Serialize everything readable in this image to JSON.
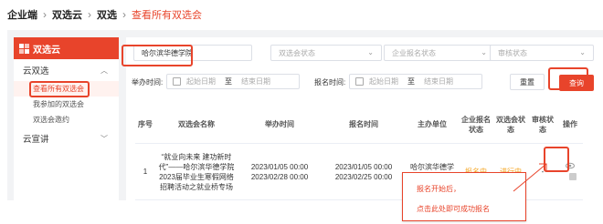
{
  "breadcrumb": {
    "root": "企业端",
    "level1": "双选云",
    "level2": "双选",
    "current": "查看所有双选会"
  },
  "sidebar": {
    "brand": "双选云",
    "groups": [
      {
        "label": "云双选",
        "expanded": true,
        "items": [
          "查看所有双选会",
          "我参加的双选会",
          "双选会邀约"
        ]
      },
      {
        "label": "云宣讲",
        "expanded": false,
        "items": []
      }
    ]
  },
  "filters": {
    "school": "哈尔滨华德学院",
    "status_placeholder": "双选会状态",
    "enroll_placeholder": "企业报名状态",
    "audit_placeholder": "审核状态"
  },
  "dates": {
    "hold_label": "举办时间:",
    "enroll_label": "报名时间:",
    "start_placeholder": "起始日期",
    "to": "至",
    "end_placeholder": "结束日期"
  },
  "buttons": {
    "reset": "重置",
    "query": "查询"
  },
  "table": {
    "headers": [
      "序号",
      "双选会名称",
      "举办时间",
      "报名时间",
      "主办单位",
      "企业报名状态",
      "双选会状态",
      "审核状态",
      "操作"
    ],
    "rows": [
      {
        "index": "1",
        "name": "“就业向未来 建功新时代”——哈尔滨华德学院2023届毕业生寒假网络招聘活动之就业桥专场",
        "hold_time": "2023/01/05 00:00\n2023/02/28 00:00",
        "enroll_time": "2023/01/05 00:00\n2023/02/25 00:00",
        "organizer": "哈尔滨华德学院",
        "enroll_status": "报名中",
        "fair_status": "进行中",
        "audit_status": "-"
      }
    ]
  },
  "callout": {
    "line1": "报名开始后，",
    "line2": "点击此处即可成功报名"
  },
  "colors": {
    "accent": "#e8442b",
    "orange": "#f5a623"
  },
  "icons": {
    "brand": "cloud-logo-icon",
    "view": "eye-icon",
    "calendar": "calendar-icon"
  }
}
